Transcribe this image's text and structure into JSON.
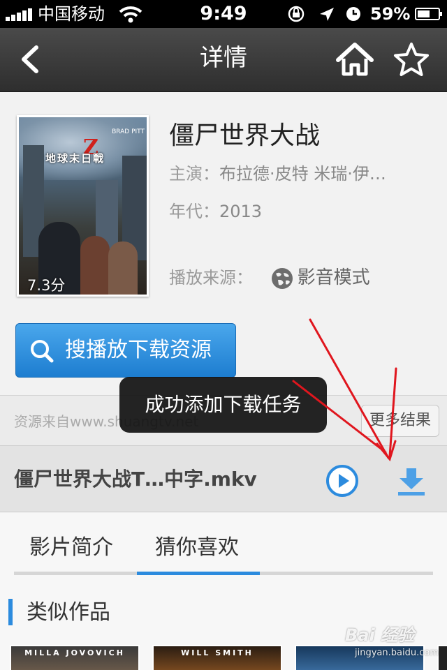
{
  "status_bar": {
    "carrier": "中国移动",
    "time": "9:49",
    "battery": "59%",
    "battery_level": 0.59
  },
  "nav": {
    "title": "详情"
  },
  "movie": {
    "title": "僵尸世界大战",
    "cast_label": "主演：",
    "cast": "布拉德·皮特 米瑞·伊…",
    "year_label": "年代：",
    "year": "2013",
    "source_label": "播放来源：",
    "source": "影音模式",
    "rating": "7.3分"
  },
  "search_button": {
    "label": "搜播放下载资源"
  },
  "source_bar": {
    "note": "资源来自www.shuangtv.net",
    "more_results": "更多结果"
  },
  "file": {
    "name": "僵尸世界大战T…中字.mkv"
  },
  "tabs": [
    {
      "label": "影片简介",
      "active": false
    },
    {
      "label": "猜你喜欢",
      "active": true
    }
  ],
  "similar": {
    "heading": "类似作品",
    "items": [
      {
        "caption": "MILLA JOVOVICH"
      },
      {
        "caption": "WILL SMITH"
      },
      {
        "caption": ""
      }
    ]
  },
  "toast": {
    "message": "成功添加下载任务"
  },
  "watermark": {
    "logo": "Bai 经验",
    "url": "jingyan.baidu.com"
  },
  "colors": {
    "accent": "#2c8bde",
    "nav_bg": "#3a3a3a",
    "annotation_arrow": "#e0161e"
  }
}
